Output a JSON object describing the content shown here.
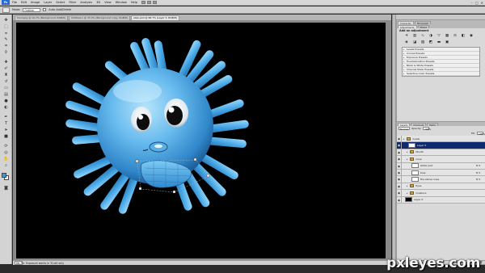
{
  "menubar": {
    "logo": "Ps",
    "items": [
      "File",
      "Edit",
      "Image",
      "Layer",
      "Select",
      "Filter",
      "Analysis",
      "3D",
      "View",
      "Window",
      "Help"
    ],
    "window_controls": [
      "–",
      "□",
      "✕"
    ]
  },
  "options_bar": {
    "mode_label": "Mode:",
    "mode_value": "Outline",
    "check_label": "Auto Add/Delete"
  },
  "tabs": [
    {
      "label": "hand.jpg @ 16.7% (Background, RGB/8)",
      "active": false
    },
    {
      "label": "Untitled-1 @ 33.3% (Background copy, RGB/8)",
      "active": false
    },
    {
      "label": "alien.psd @ 66.7% (Layer 5, RGB/8)",
      "active": true
    }
  ],
  "status": {
    "zoom": "66.7%",
    "info": "Exposure works in 32-bit only"
  },
  "right_panel": {
    "top_tabs": [
      "Adjustments",
      "Masks"
    ],
    "mini_tabs": [
      "Character",
      "Paragraph"
    ],
    "adjustments_title": "Add an adjustment",
    "adjustment_icons": [
      "brightness-icon",
      "levels-icon",
      "curves-icon",
      "exposure-icon",
      "vibrance-icon",
      "hue-sat-icon",
      "color-balance-icon",
      "bw-icon",
      "photo-filter-icon",
      "channel-mixer-icon",
      "invert-icon",
      "posterize-icon",
      "threshold-icon",
      "gradient-map-icon",
      "selective-color-icon"
    ],
    "presets": [
      "Levels Presets",
      "Curves Presets",
      "Exposure Presets",
      "Hue/Saturation Presets",
      "Black & White Presets",
      "Channel Mixer Presets",
      "Selective Color Presets"
    ],
    "layers_tabs": [
      "Layers",
      "Channels",
      "Paths"
    ],
    "blend_mode": "Normal",
    "opacity_label": "Opacity:",
    "opacity_value": "100%",
    "fill_label": "Fill:",
    "fill_value": "100%",
    "layers": [
      {
        "name": "Guide",
        "kind": "group",
        "indent": 0,
        "fx": false,
        "selected": false
      },
      {
        "name": "Layer 5",
        "kind": "layer",
        "indent": 1,
        "fx": false,
        "selected": true
      },
      {
        "name": "Mouth",
        "kind": "group",
        "indent": 1,
        "fx": false,
        "selected": false
      },
      {
        "name": "nose",
        "kind": "group",
        "indent": 1,
        "fx": false,
        "selected": false
      },
      {
        "name": "white part",
        "kind": "layer",
        "indent": 2,
        "fx": true,
        "selected": false
      },
      {
        "name": "blue",
        "kind": "layer",
        "indent": 2,
        "fx": true,
        "selected": false
      },
      {
        "name": "the above nose",
        "kind": "layer",
        "indent": 2,
        "fx": true,
        "selected": false
      },
      {
        "name": "Eyes",
        "kind": "group",
        "indent": 1,
        "fx": false,
        "selected": false
      },
      {
        "name": "Creature",
        "kind": "group",
        "indent": 1,
        "fx": false,
        "selected": false
      },
      {
        "name": "Layer 0",
        "kind": "layer-black",
        "indent": 0,
        "fx": false,
        "selected": false
      }
    ],
    "footer_icons": [
      "link-icon",
      "fx-icon",
      "mask-icon",
      "adjustment-icon",
      "folder-icon",
      "new-layer-icon",
      "trash-icon"
    ]
  },
  "watermark": "pxleyes.com",
  "colors": {
    "foreground": "#3b9ad9",
    "background": "#ffffff",
    "creature_body": "#64b8ec",
    "canvas": "#000000"
  }
}
